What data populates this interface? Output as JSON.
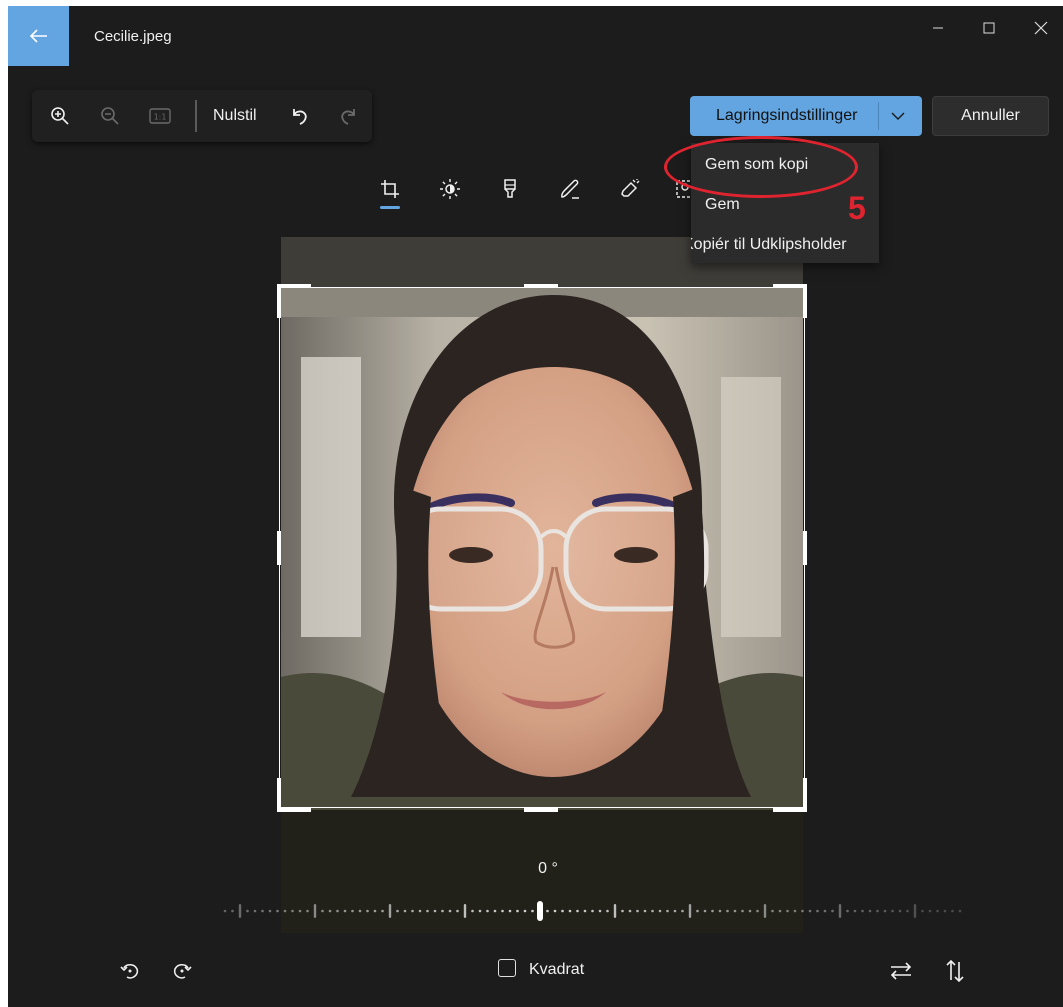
{
  "window": {
    "title": "Cecilie.jpeg"
  },
  "titlebar": {
    "back_icon": "arrow-left-icon",
    "controls": [
      "minimize-icon",
      "maximize-icon",
      "close-icon"
    ]
  },
  "toolbar": {
    "icons": [
      "zoom-in-icon",
      "zoom-out-icon",
      "actual-size-icon"
    ],
    "reset_label": "Nulstil",
    "undo_icon": "undo-icon",
    "redo_icon": "redo-icon"
  },
  "save": {
    "label": "Lagringsindstillinger",
    "dropdown_icon": "chevron-down-icon",
    "cancel_label": "Annuller"
  },
  "menu": {
    "items": [
      "Gem som kopi",
      "Gem",
      "Kopiér til Udklipsholder"
    ]
  },
  "annotation": {
    "step": "5",
    "color": "#e0242f"
  },
  "tools": [
    "crop-icon",
    "brightness-icon",
    "filter-icon",
    "markup-icon",
    "erase-icon",
    "background-icon"
  ],
  "crop": {
    "angle_label": "0 °",
    "square_label": "Kvadrat",
    "square_checked": false
  },
  "colors": {
    "accent": "#62a5e0",
    "window_bg": "#1c1c1c",
    "menu_bg": "#2b2b2b"
  }
}
